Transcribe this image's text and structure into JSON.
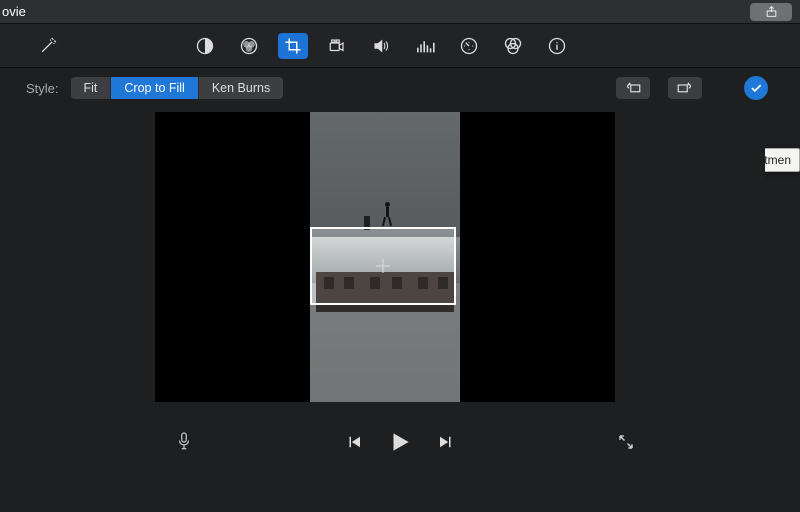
{
  "titlebar": {
    "title": "ovie"
  },
  "toolbar": {
    "icons": [
      "wand",
      "contrast",
      "color-wheel",
      "crop",
      "camera",
      "volume",
      "equalizer",
      "speed",
      "color-filter",
      "info"
    ],
    "active": "crop"
  },
  "style": {
    "label": "Style:",
    "options": {
      "fit": "Fit",
      "crop_to_fill": "Crop to Fill",
      "ken_burns": "Ken Burns"
    },
    "selected": "crop_to_fill"
  },
  "apply": {
    "tooltip": "Apply crop adjustmen"
  },
  "transport": {
    "icons": [
      "microphone",
      "prev",
      "play",
      "next",
      "fullscreen"
    ]
  }
}
